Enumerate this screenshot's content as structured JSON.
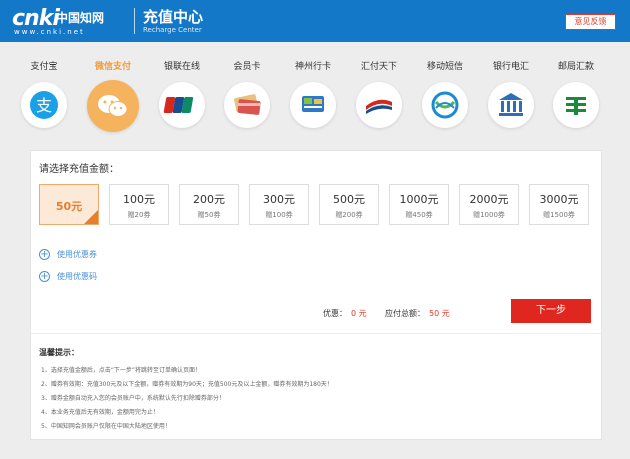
{
  "header": {
    "logo_mark": "cnki",
    "logo_cn": "中国知网",
    "logo_url": "www.cnki.net",
    "title": "充值中心",
    "subtitle": "Recharge Center",
    "feedback_label": "意见反馈"
  },
  "methods": [
    {
      "label": "支付宝",
      "icon": "alipay-icon",
      "active": false
    },
    {
      "label": "微信支付",
      "icon": "wechat-icon",
      "active": true
    },
    {
      "label": "银联在线",
      "icon": "unionpay-icon",
      "active": false
    },
    {
      "label": "会员卡",
      "icon": "member-card-icon",
      "active": false
    },
    {
      "label": "神州行卡",
      "icon": "shenzhouxing-card-icon",
      "active": false
    },
    {
      "label": "汇付天下",
      "icon": "chinapnr-icon",
      "active": false
    },
    {
      "label": "移动短信",
      "icon": "china-mobile-icon",
      "active": false
    },
    {
      "label": "银行电汇",
      "icon": "bank-icon",
      "active": false
    },
    {
      "label": "邮局汇款",
      "icon": "post-office-icon",
      "active": false
    }
  ],
  "amount_section": {
    "title": "请选择充值金额：",
    "amounts": [
      {
        "value": "50元",
        "gift": "",
        "selected": true
      },
      {
        "value": "100元",
        "gift": "赠20券",
        "selected": false
      },
      {
        "value": "200元",
        "gift": "赠50券",
        "selected": false
      },
      {
        "value": "300元",
        "gift": "赠100券",
        "selected": false
      },
      {
        "value": "500元",
        "gift": "赠200券",
        "selected": false
      },
      {
        "value": "1000元",
        "gift": "赠450券",
        "selected": false
      },
      {
        "value": "2000元",
        "gift": "赠1000券",
        "selected": false
      },
      {
        "value": "3000元",
        "gift": "赠1500券",
        "selected": false
      }
    ]
  },
  "coupons": {
    "voucher_label": "使用优惠券",
    "code_label": "使用优惠码"
  },
  "summary": {
    "discount_label": "优惠：",
    "discount_value": "0 元",
    "total_label": "应付总额：",
    "total_value": "50 元",
    "next_label": "下一步"
  },
  "tips": {
    "title": "温馨提示：",
    "items": [
      "1、选择充值金额后，点击“下一步”将跳转至订单确认页面！",
      "2、赠券有效期：充值300元及以下金额，赠券有效期为90天；充值500元及以上金额，赠券有效期为180天！",
      "3、赠券金额自动充入您的会员账户中，系统默认先行扣除赠券部分！",
      "4、本业务充值后无有效期，金额用完为止！",
      "5、中国知网会员账户仅限在中国大陆地区使用！"
    ]
  },
  "colors": {
    "header_bg": "#1478c8",
    "active_tab": "#f39c3c",
    "next_button": "#e0271f",
    "selected_amount_bg": "#fde9d8",
    "link": "#4a8fd4"
  }
}
